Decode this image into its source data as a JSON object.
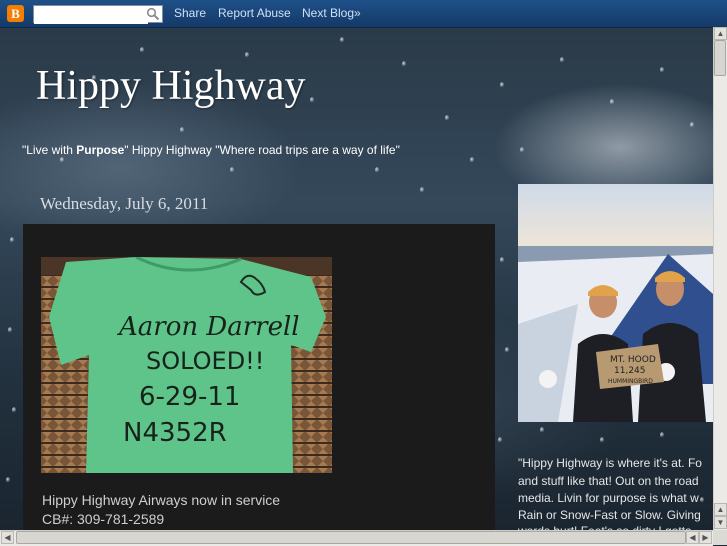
{
  "navbar": {
    "logo_letter": "B",
    "search": {
      "value": "",
      "placeholder": ""
    },
    "links": [
      "Share",
      "Report Abuse",
      "Next Blog»"
    ]
  },
  "header": {
    "title": "Hippy Highway",
    "description": {
      "part1": "\"Live with ",
      "bold": "Purpose",
      "part2": "\" Hippy Highway \"Where road trips are a way of life\""
    }
  },
  "post": {
    "date": "Wednesday, July 6, 2011",
    "shirt_text": [
      "Aaron Darrell",
      "SOLOED!!",
      "6-29-11",
      "N4352R"
    ],
    "lines": [
      "Hippy Highway Airways now in service",
      "CB#: 309-781-2589"
    ]
  },
  "sidebar": {
    "sign_text": [
      "MT. HOOD",
      "11,245",
      "HUMMINGBIRD"
    ],
    "lines": [
      "\"Hippy Highway is where it's at. Fo",
      "and stuff like that! Out on the road",
      "media. Livin for purpose is what w",
      "Rain or Snow-Fast or Slow. Giving",
      "words hurt! Feet's so dirty I gotta"
    ]
  },
  "colors": {
    "navbar": "#1a467a",
    "accent_logo": "#f57d00",
    "post_bg": "#1b1b1b",
    "shirt": "#5fc48a"
  }
}
